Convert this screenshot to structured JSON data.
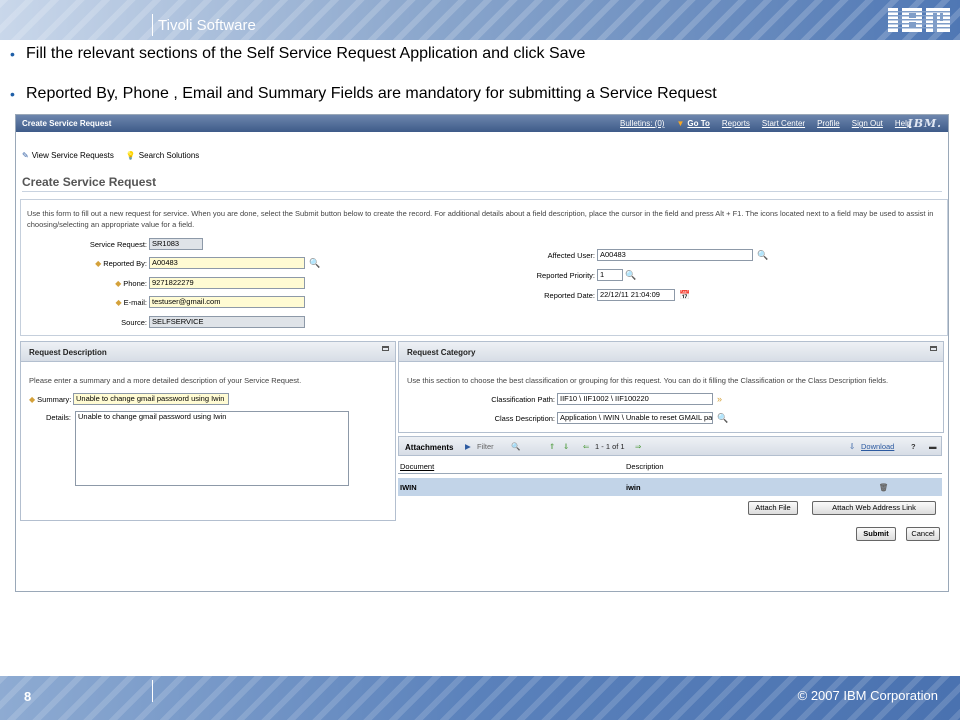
{
  "slide": {
    "product": "Tivoli Software",
    "logo": "IBM",
    "bullets": [
      "Fill the relevant sections of the Self Service Request Application and click Save",
      "Reported By, Phone , Email and Summary Fields are mandatory for submitting a Service Request"
    ],
    "page_number": "8",
    "copyright": "© 2007 IBM Corporation"
  },
  "app": {
    "title": "Create Service Request",
    "nav": {
      "bulletins": "Bulletins: (0)",
      "goto": "Go To",
      "reports": "Reports",
      "start_center": "Start Center",
      "profile": "Profile",
      "sign_out": "Sign Out",
      "help": "Help",
      "logo": "IBM."
    },
    "toolbar": {
      "view_requests": "View Service Requests",
      "search_solutions": "Search Solutions"
    },
    "page_title": "Create Service Request",
    "intro": "Use this form to fill out a new request for service. When you are done, select the Submit button below to create the record. For additional details about a field description, place the cursor in the field and press Alt + F1. The icons located next to a field may be used to assist in choosing/selecting an appropriate value for a field.",
    "fields": {
      "service_request": {
        "label": "Service Request:",
        "value": "SR1083"
      },
      "reported_by": {
        "label": "Reported By:",
        "value": "A00483"
      },
      "phone": {
        "label": "Phone:",
        "value": "9271822279"
      },
      "email": {
        "label": "E-mail:",
        "value": "testuser@gmail.com"
      },
      "source": {
        "label": "Source:",
        "value": "SELFSERVICE"
      },
      "affected_user": {
        "label": "Affected User:",
        "value": "A00483"
      },
      "reported_priority": {
        "label": "Reported Priority:",
        "value": "1"
      },
      "reported_date": {
        "label": "Reported Date:",
        "value": "22/12/11 21:04:09"
      }
    },
    "request_description": {
      "title": "Request Description",
      "hint": "Please enter a summary and a more detailed description of your Service Request.",
      "summary_label": "Summary:",
      "summary_value": "Unable to change gmail password using Iwin",
      "details_label": "Details:",
      "details_value": "Unable to change gmail password using Iwin"
    },
    "request_category": {
      "title": "Request Category",
      "hint": "Use this section to choose the best classification or grouping for this request. You can do it filling the Classification or the Class Description fields.",
      "classification_label": "Classification Path:",
      "classification_value": "IIF10 \\ IIF1002 \\ IIF100220",
      "class_desc_label": "Class Description:",
      "class_desc_value": "Application \\ IWIN \\ Unable to reset GMAIL pass"
    },
    "attachments": {
      "title": "Attachments",
      "filter": "Filter",
      "paging": "1 - 1 of 1",
      "download": "Download",
      "columns": [
        "Document",
        "Description"
      ],
      "rows": [
        {
          "document": "IWIN",
          "description": "iwin"
        }
      ],
      "attach_file": "Attach File",
      "attach_web": "Attach Web Address Link"
    },
    "buttons": {
      "submit": "Submit",
      "cancel": "Cancel"
    }
  }
}
